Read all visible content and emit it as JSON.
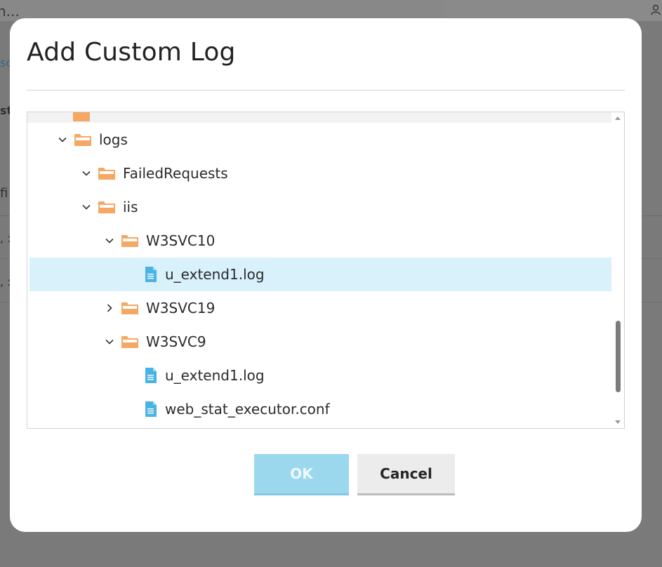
{
  "background": {
    "search_text": "h...",
    "fragments": [
      "sc",
      "st",
      "fi",
      ", :",
      ", :"
    ]
  },
  "dialog": {
    "title": "Add Custom Log",
    "buttons": {
      "ok": "OK",
      "cancel": "Cancel"
    }
  },
  "tree": {
    "nodes": [
      {
        "label": "logs",
        "type": "folder",
        "expanded": true
      },
      {
        "label": "FailedRequests",
        "type": "folder",
        "expanded": true
      },
      {
        "label": "iis",
        "type": "folder",
        "expanded": true
      },
      {
        "label": "W3SVC10",
        "type": "folder",
        "expanded": true
      },
      {
        "label": "u_extend1.log",
        "type": "file",
        "selected": true
      },
      {
        "label": "W3SVC19",
        "type": "folder",
        "expanded": false
      },
      {
        "label": "W3SVC9",
        "type": "folder",
        "expanded": true
      },
      {
        "label": "u_extend1.log",
        "type": "file"
      },
      {
        "label": "web_stat_executor.conf",
        "type": "file"
      }
    ]
  },
  "icons": {
    "folder": "folder-icon",
    "file": "file-icon",
    "expanded": "chevron-down-icon",
    "collapsed": "chevron-right-icon"
  },
  "colors": {
    "folder": "#f5a863",
    "file": "#4ab3e4",
    "selected_row": "#d8f1fb",
    "ok_button": "#9bd8ee"
  }
}
